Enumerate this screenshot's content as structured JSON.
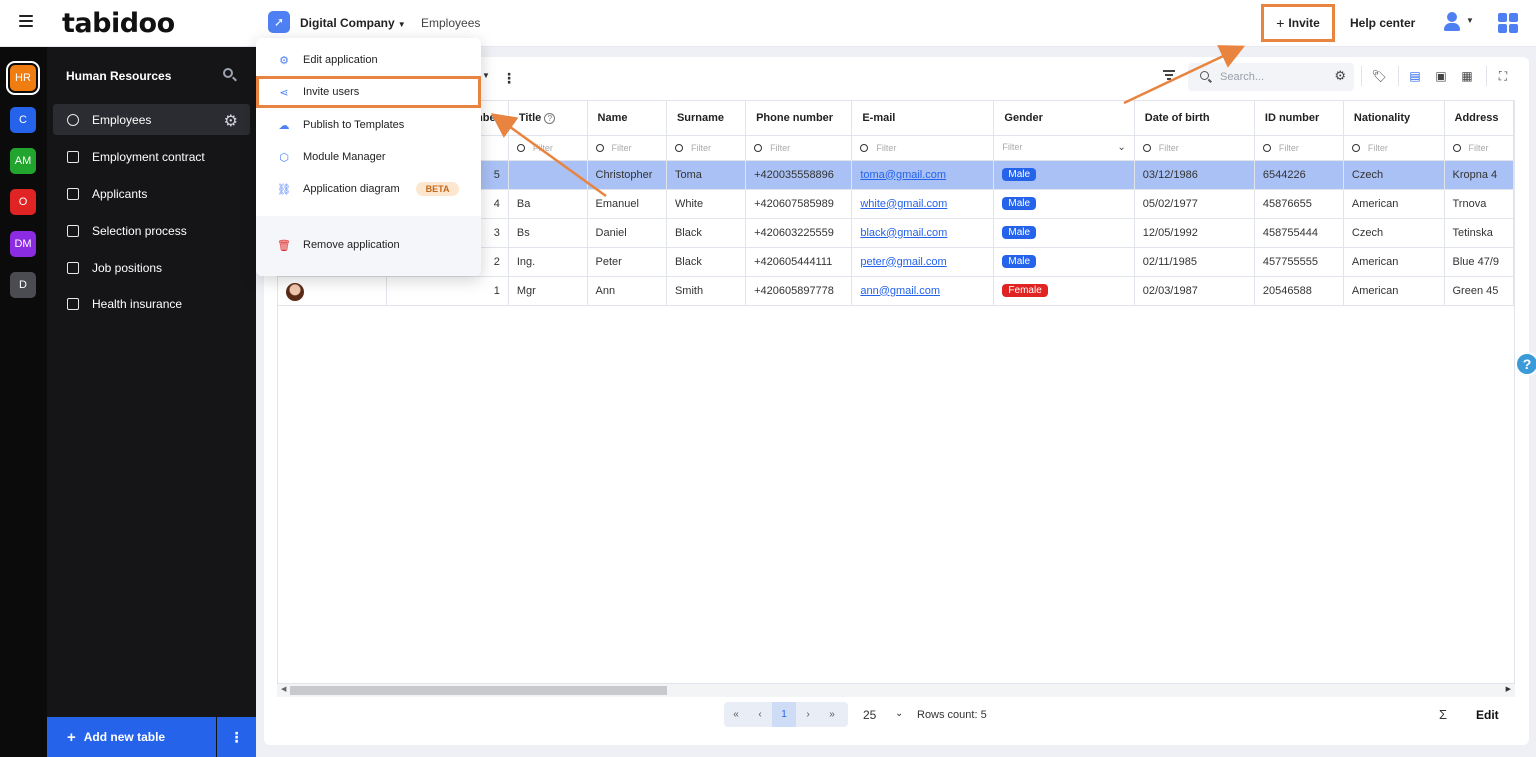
{
  "header": {
    "logo": "tabidoo",
    "company": "Digital Company",
    "breadcrumb": "Employees",
    "invite_label": "Invite",
    "help_label": "Help center"
  },
  "rail": [
    {
      "label": "HR",
      "color": "#f07d12"
    },
    {
      "label": "C",
      "color": "#2563eb"
    },
    {
      "label": "AM",
      "color": "#22a52f"
    },
    {
      "label": "O",
      "color": "#e02424"
    },
    {
      "label": "DM",
      "color": "#8b2be2"
    },
    {
      "label": "D",
      "color": "#4a4c52"
    }
  ],
  "sidebar": {
    "title": "Human Resources",
    "items": [
      {
        "label": "Employees",
        "icon": "person-circle-icon"
      },
      {
        "label": "Employment contract",
        "icon": "contract-icon"
      },
      {
        "label": "Applicants",
        "icon": "applicants-icon"
      },
      {
        "label": "Selection process",
        "icon": "scales-icon"
      },
      {
        "label": "Job positions",
        "icon": "grid-icon"
      },
      {
        "label": "Health insurance",
        "icon": "medical-kit-icon"
      }
    ],
    "add_table_label": "Add new table"
  },
  "menu": {
    "items": [
      {
        "label": "Edit application",
        "icon": "gear-icon"
      },
      {
        "label": "Invite users",
        "icon": "share-icon"
      },
      {
        "label": "Publish to Templates",
        "icon": "cloud-upload-icon"
      },
      {
        "label": "Module Manager",
        "icon": "cube-icon"
      },
      {
        "label": "Application diagram",
        "icon": "diagram-icon",
        "badge": "BETA"
      },
      {
        "label": "Remove application",
        "icon": "trash-icon"
      }
    ]
  },
  "toolbar": {
    "search_placeholder": "Search..."
  },
  "table": {
    "columns": [
      "",
      "mber",
      "Title",
      "Name",
      "Surname",
      "Phone number",
      "E-mail",
      "Gender",
      "Date of birth",
      "ID number",
      "Nationality",
      "Address"
    ],
    "filter_placeholder": "Filter",
    "rows": [
      {
        "num": "5",
        "title": "",
        "name": "Christopher",
        "surname": "Toma",
        "phone": "+420035558896",
        "email": "toma@gmail.com",
        "gender": "Male",
        "dob": "03/12/1986",
        "id": "6544226",
        "nationality": "Czech",
        "address": "Kropna 4"
      },
      {
        "num": "4",
        "title": "Ba",
        "name": "Emanuel",
        "surname": "White",
        "phone": "+420607585989",
        "email": "white@gmail.com",
        "gender": "Male",
        "dob": "05/02/1977",
        "id": "45876655",
        "nationality": "American",
        "address": "Trnova"
      },
      {
        "num": "3",
        "title": "Bs",
        "name": "Daniel",
        "surname": "Black",
        "phone": "+420603225559",
        "email": "black@gmail.com",
        "gender": "Male",
        "dob": "12/05/1992",
        "id": "458755444",
        "nationality": "Czech",
        "address": "Tetinska"
      },
      {
        "num": "2",
        "title": "Ing.",
        "name": "Peter",
        "surname": "Black",
        "phone": "+420605444111",
        "email": "peter@gmail.com",
        "gender": "Male",
        "dob": "02/11/1985",
        "id": "457755555",
        "nationality": "American",
        "address": "Blue 47/9"
      },
      {
        "num": "1",
        "title": "Mgr",
        "name": "Ann",
        "surname": "Smith",
        "phone": "+420605897778",
        "email": "ann@gmail.com",
        "gender": "Female",
        "dob": "02/03/1987",
        "id": "20546588",
        "nationality": "American",
        "address": "Green 45"
      }
    ]
  },
  "footer": {
    "current_page": "1",
    "per_page": "25",
    "rows_count": "Rows count: 5",
    "sigma": "Σ",
    "edit_label": "Edit"
  },
  "colors": {
    "accent": "#2563eb",
    "highlight_box": "#e8843f",
    "selected_row": "#a9c1f5"
  }
}
